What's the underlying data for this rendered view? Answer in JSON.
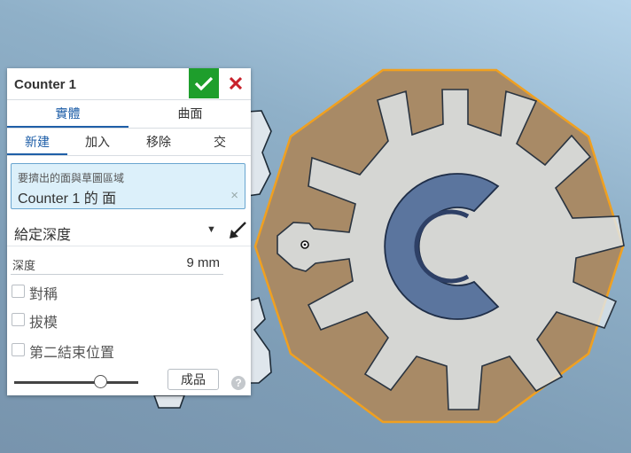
{
  "feature_panel": {
    "title": "Counter 1",
    "accept_icon": "checkmark-icon",
    "cancel_icon": "close-x-icon",
    "body_type_tabs": [
      {
        "label": "實體",
        "active": true
      },
      {
        "label": "曲面",
        "active": false
      }
    ],
    "operation_tabs": [
      {
        "label": "新建",
        "active": true
      },
      {
        "label": "加入",
        "active": false
      },
      {
        "label": "移除",
        "active": false
      },
      {
        "label": "交",
        "active": false
      }
    ],
    "selection": {
      "label": "要擠出的面與草圖區域",
      "item": "Counter 1 的 面",
      "clear_icon": "×"
    },
    "end_type": "給定深度",
    "depth": {
      "label": "深度",
      "value": "9 mm"
    },
    "options": [
      {
        "label": "對稱",
        "checked": false
      },
      {
        "label": "拔模",
        "checked": false
      },
      {
        "label": "第二結束位置",
        "checked": false
      }
    ],
    "final_button": "成品",
    "help_icon": "?",
    "colors": {
      "accept_green": "#1e9e2c",
      "cancel_red": "#c8202a",
      "tab_blue": "#1f5fa8",
      "selection_bg": "#dcf0fa",
      "gear_face": "#a88a66",
      "gear_edge": "#f0a020",
      "gear_hub": "#4e6a98"
    }
  }
}
